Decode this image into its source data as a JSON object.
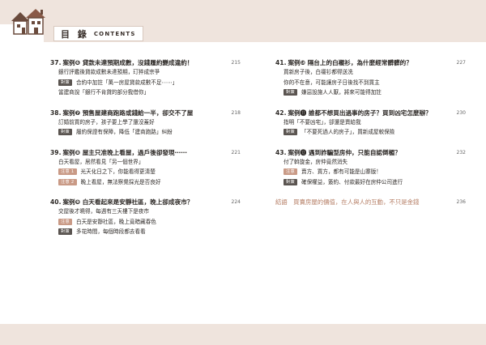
{
  "header": {
    "title_zh": "目 錄",
    "title_en": "CONTENTS"
  },
  "colors": {
    "band": "#efe4dd",
    "tag_dark": "#5a5450",
    "tag_light": "#c99a86",
    "epilogue": "#b57d64"
  },
  "left_column": [
    {
      "num": "37.",
      "case": "案例",
      "badge": "6",
      "title": "貸款未達預期成數，沒錢履約變成違約！",
      "page": "215",
      "lines": [
        {
          "tag": "",
          "text": "銀行評鑑後貸款成數未達預期，玎猝成宗爭"
        },
        {
          "tag": "對策",
          "text": "合約中加註「萬一房屋貸款成數不足⋯⋯」"
        },
        {
          "tag": "",
          "text": "當建商說「銀行不肯貸的部分我借你」"
        }
      ]
    },
    {
      "num": "38.",
      "case": "案例",
      "badge": "7",
      "title": "預售屋建商跑路或錢給一半，卻交不了屋",
      "page": "218",
      "lines": [
        {
          "tag": "",
          "text": "訂婚前買的房子，孩子要上學了還沒蓋好"
        },
        {
          "tag": "對策",
          "text": "履約保證有保障，降低「建商跑路」糾紛"
        }
      ]
    },
    {
      "num": "39.",
      "case": "案例",
      "badge": "8",
      "title": "屋主只准晚上看屋，過戶後卻發現⋯⋯",
      "page": "221",
      "lines": [
        {
          "tag": "",
          "text": "白天看屋，居然看見「另一個世界」"
        },
        {
          "tag": "注意 1",
          "text": "光天化日之下，你能看得更清楚"
        },
        {
          "tag": "注意 2",
          "text": "晚上看屋，無法察覺採光是否良好"
        }
      ]
    },
    {
      "num": "40.",
      "case": "案例",
      "badge": "9",
      "title": "白天看起來是安靜社區，晚上卻成夜市？",
      "page": "224",
      "lines": [
        {
          "tag": "",
          "text": "交屋後才曉得，每週有三天樓下是夜市"
        },
        {
          "tag": "注意",
          "text": "白天是安靜社區，晚上竟暗藏春色"
        },
        {
          "tag": "對策",
          "text": "多花時間，每個時段都去看看"
        }
      ]
    }
  ],
  "right_column": [
    {
      "num": "41.",
      "case": "案例",
      "badge": "10",
      "title": "隔台上的白襯衫，為什麼經常髒髒的？",
      "page": "227",
      "lines": [
        {
          "tag": "",
          "text": "買新房子後，白襯衫都得送洗"
        },
        {
          "tag": "",
          "text": "你的不在意，可能讓房子日後找不到買主"
        },
        {
          "tag": "對策",
          "text": "嫌惡設施人人厭，將來可能得加註"
        }
      ]
    },
    {
      "num": "42.",
      "case": "案例",
      "badge": "11",
      "title": "誰都不想買出過事的房子？買到凶宅怎麼辦？",
      "page": "230",
      "lines": [
        {
          "tag": "",
          "text": "指明「不要凶宅」，卻還是賣給我"
        },
        {
          "tag": "對策",
          "text": "「不要死過人的房子」，買新成屋較保險"
        }
      ]
    },
    {
      "num": "43.",
      "case": "案例",
      "badge": "12",
      "title": "遇到詐騙型房仲，只能自認倒楣？",
      "page": "232",
      "lines": [
        {
          "tag": "",
          "text": "付了斡旋金，房仲竟然消失"
        },
        {
          "tag": "注意",
          "text": "賣方、買方，都有可能是山寨版！"
        },
        {
          "tag": "對策",
          "text": "確保權益，簽約、付款最好在房仲公司進行"
        }
      ]
    }
  ],
  "epilogue": {
    "text": "結語　買賣房屋的價值，在人與人的互動，不只是金錢",
    "page": "236"
  }
}
